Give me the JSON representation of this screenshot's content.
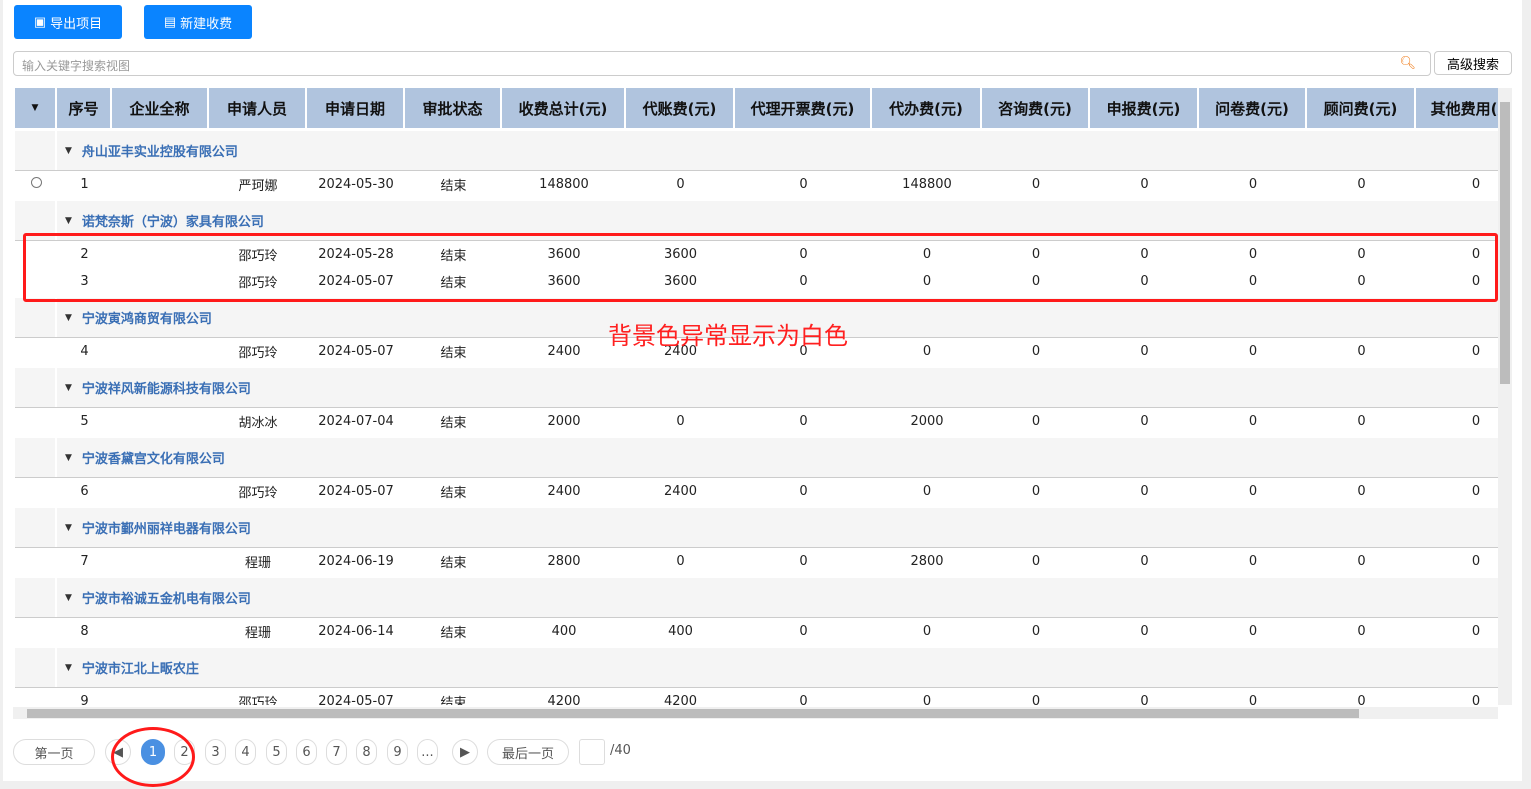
{
  "toolbar": {
    "export_label": "导出项目",
    "new_label": "新建收费"
  },
  "search": {
    "placeholder": "输入关键字搜索视图",
    "advanced_label": "高级搜索"
  },
  "columns": [
    "序号",
    "企业全称",
    "申请人员",
    "申请日期",
    "审批状态",
    "收费总计(元)",
    "代账费(元)",
    "代理开票费(元)",
    "代办费(元)",
    "咨询费(元)",
    "申报费(元)",
    "问卷费(元)",
    "顾问费(元)",
    "其他费用(元)"
  ],
  "groups": [
    {
      "company": "舟山亚丰实业控股有限公司",
      "rows": [
        [
          "1",
          "",
          "严珂娜",
          "2024-05-30",
          "结束",
          "148800",
          "0",
          "0",
          "148800",
          "0",
          "0",
          "0",
          "0",
          "0"
        ]
      ]
    },
    {
      "company": "诺梵奈斯（宁波）家具有限公司",
      "rows": [
        [
          "2",
          "",
          "邵巧玲",
          "2024-05-28",
          "结束",
          "3600",
          "3600",
          "0",
          "0",
          "0",
          "0",
          "0",
          "0",
          "0"
        ],
        [
          "3",
          "",
          "邵巧玲",
          "2024-05-07",
          "结束",
          "3600",
          "3600",
          "0",
          "0",
          "0",
          "0",
          "0",
          "0",
          "0"
        ]
      ]
    },
    {
      "company": "宁波寅鸿商贸有限公司",
      "rows": [
        [
          "4",
          "",
          "邵巧玲",
          "2024-05-07",
          "结束",
          "2400",
          "2400",
          "0",
          "0",
          "0",
          "0",
          "0",
          "0",
          "0"
        ]
      ]
    },
    {
      "company": "宁波祥风新能源科技有限公司",
      "rows": [
        [
          "5",
          "",
          "胡冰冰",
          "2024-07-04",
          "结束",
          "2000",
          "0",
          "0",
          "2000",
          "0",
          "0",
          "0",
          "0",
          "0"
        ]
      ]
    },
    {
      "company": "宁波香黛宫文化有限公司",
      "rows": [
        [
          "6",
          "",
          "邵巧玲",
          "2024-05-07",
          "结束",
          "2400",
          "2400",
          "0",
          "0",
          "0",
          "0",
          "0",
          "0",
          "0"
        ]
      ]
    },
    {
      "company": "宁波市鄞州丽祥电器有限公司",
      "rows": [
        [
          "7",
          "",
          "程珊",
          "2024-06-19",
          "结束",
          "2800",
          "0",
          "0",
          "2800",
          "0",
          "0",
          "0",
          "0",
          "0"
        ]
      ]
    },
    {
      "company": "宁波市裕诚五金机电有限公司",
      "rows": [
        [
          "8",
          "",
          "程珊",
          "2024-06-14",
          "结束",
          "400",
          "400",
          "0",
          "0",
          "0",
          "0",
          "0",
          "0",
          "0"
        ]
      ]
    },
    {
      "company": "宁波市江北上畈农庄",
      "rows": [
        [
          "9",
          "",
          "邵巧玲",
          "2024-05-07",
          "结束",
          "4200",
          "4200",
          "0",
          "0",
          "0",
          "0",
          "0",
          "0",
          "0"
        ]
      ]
    }
  ],
  "pagination": {
    "first": "第一页",
    "last": "最后一页",
    "pages": [
      "1",
      "2",
      "3",
      "4",
      "5",
      "6",
      "7",
      "8",
      "9",
      "..."
    ],
    "current": "1",
    "total": "/40"
  },
  "annotation": {
    "text": "背景色异常显示为白色",
    "color": "#ff2020"
  },
  "colors": {
    "header": "#b0c4de",
    "button": "#0a84ff",
    "group_text": "#3a6fb5"
  }
}
